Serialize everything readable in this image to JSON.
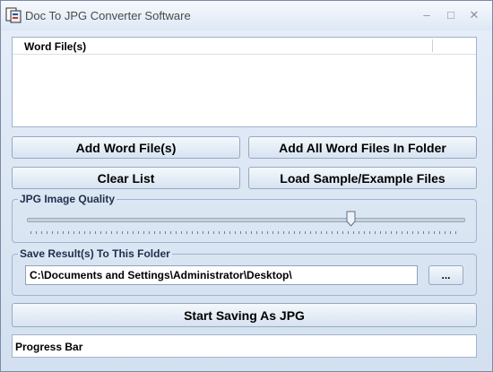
{
  "window": {
    "title": "Doc To JPG Converter Software",
    "minimize": "–",
    "maximize": "□",
    "close": "✕",
    "icon": "app-document-icon"
  },
  "file_list": {
    "header": "Word File(s)",
    "items": []
  },
  "buttons": {
    "add_word_files": "Add Word File(s)",
    "add_all_in_folder": "Add All Word Files In Folder",
    "clear_list": "Clear List",
    "load_sample": "Load Sample/Example Files",
    "start": "Start Saving As JPG",
    "browse": "..."
  },
  "quality": {
    "label": "JPG Image Quality",
    "value_fraction": 0.75
  },
  "output": {
    "label": "Save Result(s) To This Folder",
    "folder": "C:\\Documents and Settings\\Administrator\\Desktop\\"
  },
  "progress": {
    "label": "Progress Bar"
  },
  "colors": {
    "background": "#d7e4f2",
    "border": "#9fb4cf",
    "label": "#1f2f4d"
  }
}
